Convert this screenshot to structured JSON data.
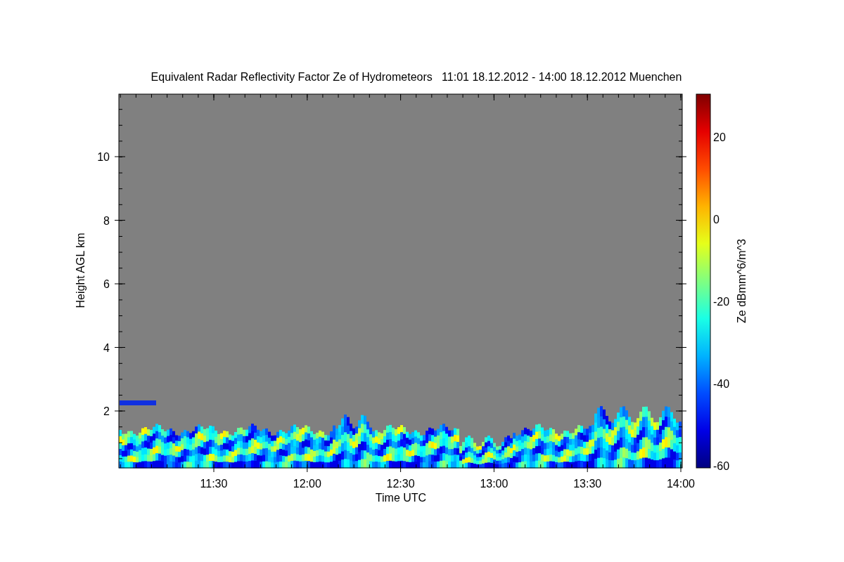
{
  "title": "Equivalent Radar Reflectivity Factor Ze of Hydrometeors   11:01 18.12.2012 - 14:00 18.12.2012 Muenchen",
  "plot": {
    "xlabel": "Time UTC",
    "ylabel": "Height AGL km",
    "xticks": [
      "11:30",
      "12:00",
      "12:30",
      "13:00",
      "13:30",
      "14:00"
    ],
    "yticks": [
      "10",
      "8",
      "6",
      "4",
      "2"
    ]
  },
  "colorbar": {
    "label": "Ze dBmm^6/m^3",
    "ticks": [
      "20",
      "0",
      "-20",
      "-40",
      "-60"
    ]
  }
}
